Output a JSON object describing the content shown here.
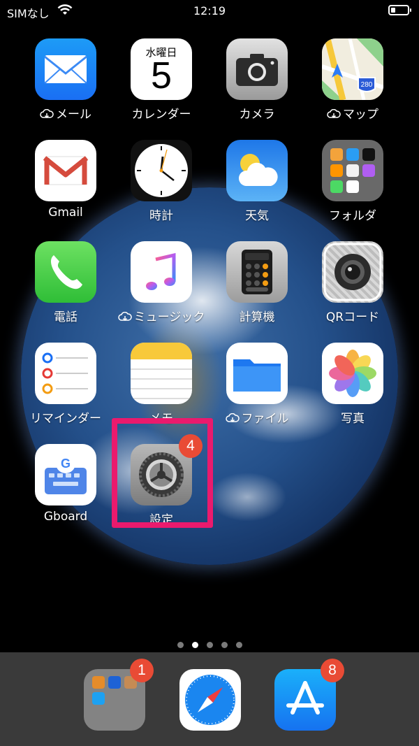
{
  "status_bar": {
    "carrier": "SIMなし",
    "time": "12:19"
  },
  "apps": [
    {
      "name": "app-mail",
      "label": "メール",
      "icon": "mail-icon",
      "cloud": true
    },
    {
      "name": "app-calendar",
      "label": "カレンダー",
      "icon": "calendar-icon",
      "weekday": "水曜日",
      "day": "5"
    },
    {
      "name": "app-camera",
      "label": "カメラ",
      "icon": "camera-icon"
    },
    {
      "name": "app-maps",
      "label": "マップ",
      "icon": "maps-icon",
      "cloud": true,
      "route": "280"
    },
    {
      "name": "app-gmail",
      "label": "Gmail",
      "icon": "gmail-icon"
    },
    {
      "name": "app-clock",
      "label": "時計",
      "icon": "clock-icon"
    },
    {
      "name": "app-weather",
      "label": "天気",
      "icon": "weather-icon"
    },
    {
      "name": "app-folder",
      "label": "フォルダ",
      "icon": "folder-icon"
    },
    {
      "name": "app-phone",
      "label": "電話",
      "icon": "phone-icon"
    },
    {
      "name": "app-music",
      "label": "ミュージック",
      "icon": "music-icon",
      "cloud": true
    },
    {
      "name": "app-calculator",
      "label": "計算機",
      "icon": "calculator-icon"
    },
    {
      "name": "app-qr",
      "label": "QRコード",
      "icon": "qr-code-icon"
    },
    {
      "name": "app-reminders",
      "label": "リマインダー",
      "icon": "reminders-icon"
    },
    {
      "name": "app-notes",
      "label": "メモ",
      "icon": "notes-icon"
    },
    {
      "name": "app-files",
      "label": "ファイル",
      "icon": "files-icon",
      "cloud": true
    },
    {
      "name": "app-photos",
      "label": "写真",
      "icon": "photos-icon"
    },
    {
      "name": "app-gboard",
      "label": "Gboard",
      "icon": "gboard-icon"
    },
    {
      "name": "app-settings",
      "label": "設定",
      "icon": "settings-icon",
      "badge": "4"
    }
  ],
  "page_indicator": {
    "pages": 5,
    "current": 2
  },
  "dock": [
    {
      "name": "dock-folder",
      "icon": "folder-icon",
      "badge": "1"
    },
    {
      "name": "dock-safari",
      "icon": "safari-icon"
    },
    {
      "name": "dock-app-store",
      "icon": "app-store-icon",
      "badge": "8"
    }
  ],
  "colors": {
    "highlight": "#ea1a6d",
    "badge": "#e94b35"
  }
}
